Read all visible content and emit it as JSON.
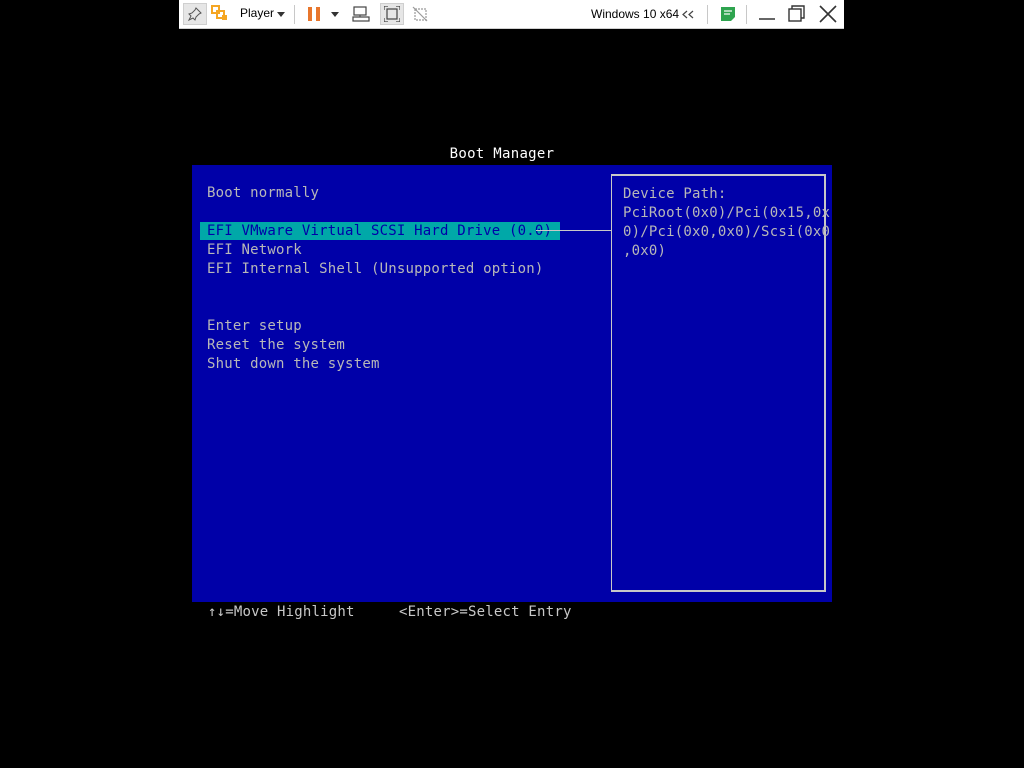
{
  "toolbar": {
    "player_label": "Player",
    "vm_name": "Windows 10 x64",
    "icons": [
      "pin-icon",
      "vmware-logo-icon",
      "chevron-down-icon",
      "pause-icon",
      "chevron-down-icon",
      "send-ctrl-alt-del-icon",
      "fit-guest-icon",
      "unity-icon",
      "collapse-arrows-icon",
      "message-log-icon",
      "minimize-icon",
      "restore-icon",
      "close-icon"
    ],
    "colors": {
      "pause": "#e8762c",
      "logo": "#f5a623",
      "log_icon": "#2ea44f"
    }
  },
  "boot": {
    "title": "Boot Manager",
    "menu": [
      "Boot normally",
      "EFI VMware Virtual SCSI Hard Drive (0.0)",
      "EFI Network",
      "EFI Internal Shell (Unsupported option)",
      "Enter setup",
      "Reset the system",
      "Shut down the system"
    ],
    "selected_index": 1,
    "device_path_title": "Device Path:",
    "device_path_lines": [
      "PciRoot(0x0)/Pci(0x15,0x",
      "0)/Pci(0x0,0x0)/Scsi(0x0",
      ",0x0)"
    ],
    "hint_move": "↑↓=Move Highlight",
    "hint_select": "<Enter>=Select Entry",
    "colors": {
      "background": "#0000a8",
      "highlight": "#00a8a8",
      "text": "#b8b8b8"
    }
  }
}
